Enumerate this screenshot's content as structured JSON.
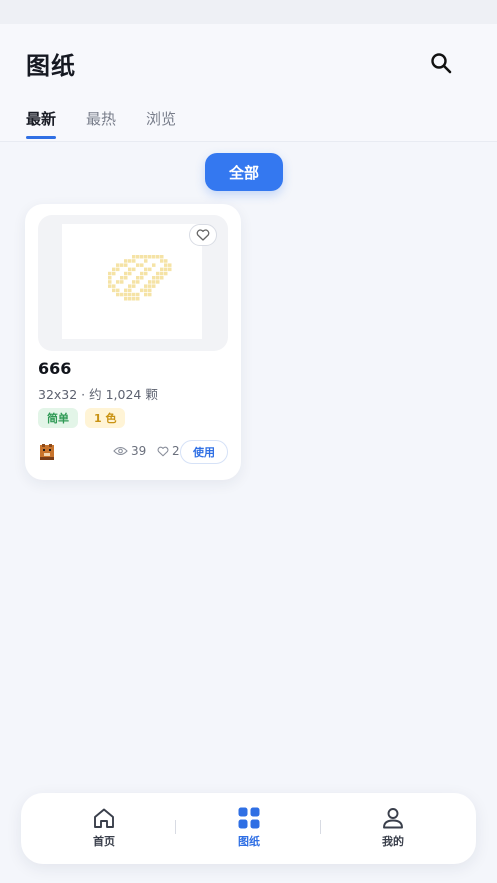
{
  "header": {
    "title": "图纸",
    "tabs": [
      {
        "label": "最新",
        "active": true
      },
      {
        "label": "最热",
        "active": false
      },
      {
        "label": "浏览",
        "active": false
      }
    ]
  },
  "filter": {
    "label": "全部"
  },
  "cards": [
    {
      "title": "666",
      "meta": "32x32 · 约 1,024 颗",
      "tags": [
        {
          "label": "简单",
          "style": "green"
        },
        {
          "label": "1 色",
          "style": "yellow"
        }
      ],
      "views": "39",
      "likes": "2",
      "use_label": "使用"
    }
  ],
  "bottom_nav": [
    {
      "label": "首页",
      "icon": "home-icon",
      "active": false
    },
    {
      "label": "图纸",
      "icon": "grid-icon",
      "active": true
    },
    {
      "label": "我的",
      "icon": "user-icon",
      "active": false
    }
  ],
  "colors": {
    "accent": "#3478f0",
    "background": "#f4f6fb",
    "tag_green_bg": "#e3f5e8",
    "tag_yellow_bg": "#fff4d6",
    "pixel_art": "#f5e3a6"
  }
}
